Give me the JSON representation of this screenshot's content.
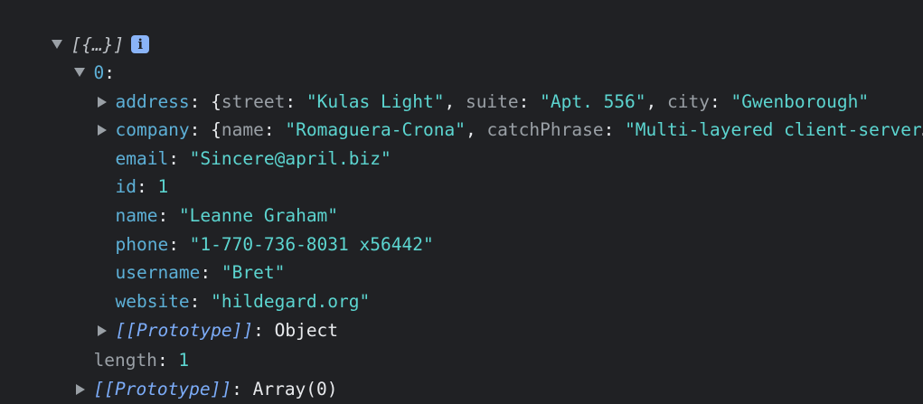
{
  "root": {
    "summary": "[{…}]",
    "info_icon": "i"
  },
  "item0": {
    "key": "0"
  },
  "address": {
    "key": "address",
    "preview_open": "{",
    "street_key": "street",
    "street_val": "\"Kulas Light\"",
    "suite_key": "suite",
    "suite_val": "\"Apt. 556\"",
    "city_key": "city",
    "city_val": "\"Gwenborough\""
  },
  "company": {
    "key": "company",
    "preview_open": "{",
    "name_key": "name",
    "name_val": "\"Romaguera-Crona\"",
    "catch_key": "catchPhrase",
    "catch_val": "\"Multi-layered client-server neural-net\""
  },
  "email": {
    "key": "email",
    "value": "\"Sincere@april.biz\""
  },
  "id": {
    "key": "id",
    "value": "1"
  },
  "name": {
    "key": "name",
    "value": "\"Leanne Graham\""
  },
  "phone": {
    "key": "phone",
    "value": "\"1-770-736-8031 x56442\""
  },
  "username": {
    "key": "username",
    "value": "\"Bret\""
  },
  "website": {
    "key": "website",
    "value": "\"hildegard.org\""
  },
  "proto_obj": {
    "key": "[[Prototype]]",
    "value": "Object"
  },
  "length": {
    "key": "length",
    "value": "1"
  },
  "proto_arr": {
    "key": "[[Prototype]]",
    "value": "Array(0)"
  },
  "colors": {
    "background": "#202124",
    "key": "#5db0d7",
    "string": "#5cd5d0",
    "number": "#9980ff",
    "proto": "#7cacf8"
  }
}
